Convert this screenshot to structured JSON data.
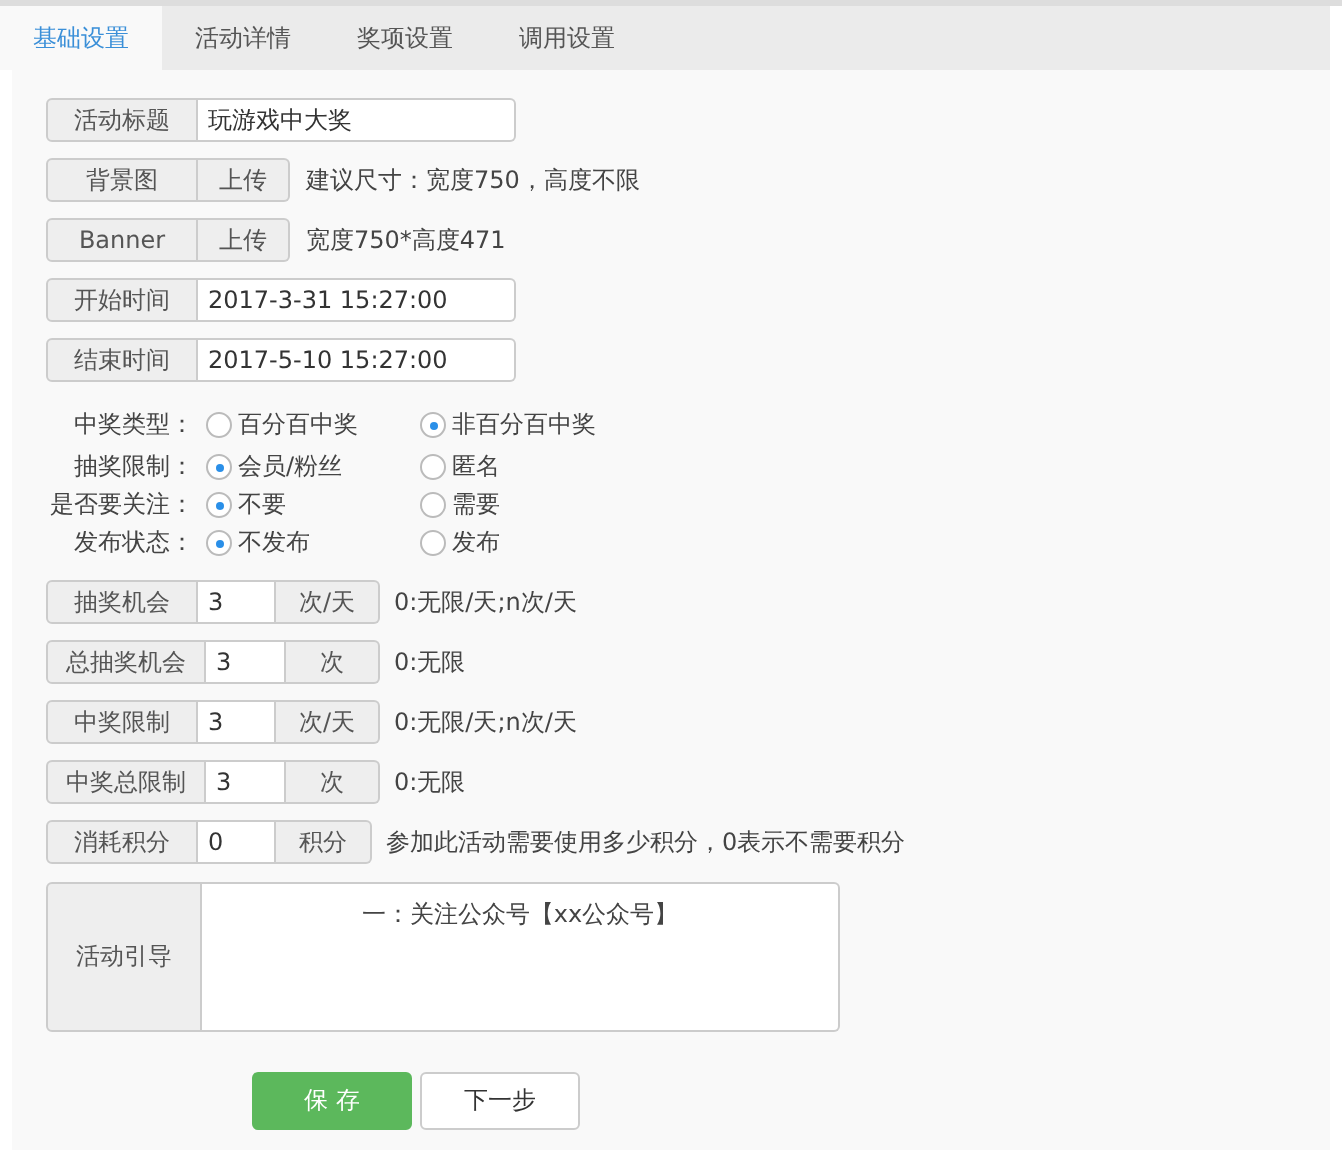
{
  "tabs": [
    {
      "label": "基础设置",
      "selected": true
    },
    {
      "label": "活动详情",
      "selected": false
    },
    {
      "label": "奖项设置",
      "selected": false
    },
    {
      "label": "调用设置",
      "selected": false
    }
  ],
  "form": {
    "fields": [
      {
        "kind": "text",
        "label": "活动标题",
        "value": "玩游戏中大奖"
      },
      {
        "kind": "upload",
        "label": "背景图",
        "button": "上传",
        "hint": "建议尺寸：宽度750，高度不限"
      },
      {
        "kind": "upload",
        "label": "Banner",
        "button": "上传",
        "hint": "宽度750*高度471"
      },
      {
        "kind": "text",
        "label": "开始时间",
        "value": "2017-3-31 15:27:00"
      },
      {
        "kind": "text",
        "label": "结束时间",
        "value": "2017-5-10 15:27:00"
      }
    ],
    "radio_groups": [
      {
        "label": "中奖类型：",
        "options": [
          {
            "label": "百分百中奖",
            "selected": false
          },
          {
            "label": "非百分百中奖",
            "selected": true
          }
        ]
      },
      {
        "label": "抽奖限制：",
        "options": [
          {
            "label": "会员/粉丝",
            "selected": true
          },
          {
            "label": "匿名",
            "selected": false
          }
        ]
      },
      {
        "label": "是否要关注：",
        "options": [
          {
            "label": "不要",
            "selected": true
          },
          {
            "label": "需要",
            "selected": false
          }
        ]
      },
      {
        "label": "发布状态：",
        "options": [
          {
            "label": "不发布",
            "selected": true
          },
          {
            "label": "发布",
            "selected": false
          }
        ]
      }
    ],
    "number_fields": [
      {
        "label": "抽奖机会",
        "value": "3",
        "unit": "次/天",
        "hint": "0:无限/天;n次/天"
      },
      {
        "label": "总抽奖机会",
        "value": "3",
        "unit": "次",
        "hint": "0:无限"
      },
      {
        "label": "中奖限制",
        "value": "3",
        "unit": "次/天",
        "hint": "0:无限/天;n次/天"
      },
      {
        "label": "中奖总限制",
        "value": "3",
        "unit": "次",
        "hint": "0:无限"
      },
      {
        "label": "消耗积分",
        "value": "0",
        "unit": "积分",
        "hint": "参加此活动需要使用多少积分，0表示不需要积分"
      }
    ],
    "guide": {
      "label": "活动引导",
      "value": "一：关注公众号【xx公众号】"
    }
  },
  "buttons": [
    {
      "label": "保 存",
      "kind": "primary"
    },
    {
      "label": "下一步",
      "kind": "default"
    }
  ]
}
